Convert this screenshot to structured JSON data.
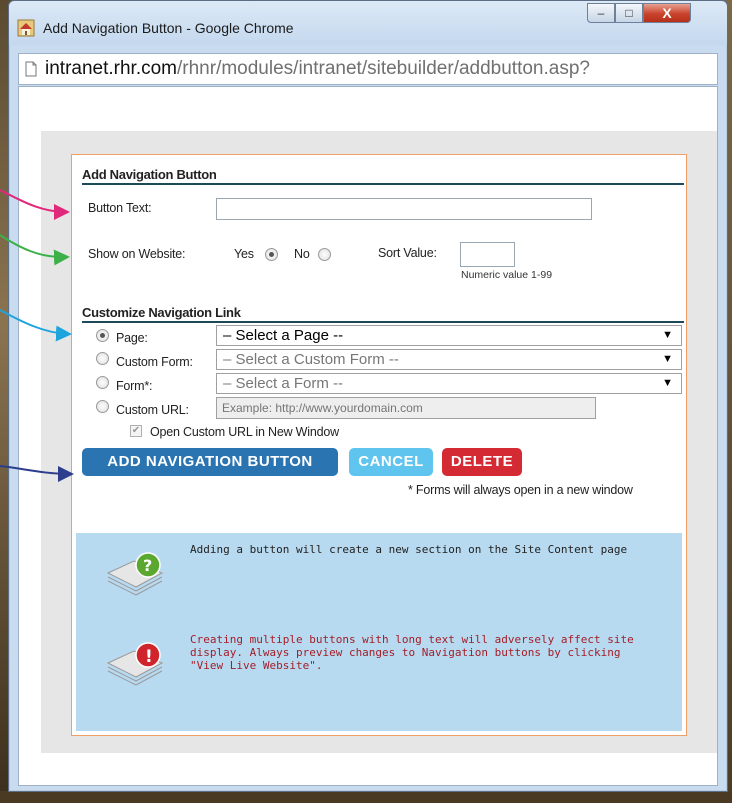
{
  "window": {
    "title": "Add Navigation Button - Google Chrome",
    "minimize_glyph": "–",
    "maximize_glyph": "□",
    "close_glyph": "X"
  },
  "address": {
    "host": "intranet.rhr.com",
    "path": "/rhnr/modules/intranet/sitebuilder/addbutton.asp?"
  },
  "form": {
    "heading": "Add Navigation Button",
    "button_text_label": "Button Text:",
    "button_text_value": "",
    "show_label": "Show on Website:",
    "yes_label": "Yes",
    "no_label": "No",
    "show_value": "Yes",
    "sort_label": "Sort Value:",
    "sort_value": "",
    "sort_hint": "Numeric value 1-99",
    "link_heading": "Customize Navigation Link",
    "link_type_selected": "Page",
    "page_label": "Page:",
    "page_select": "– Select a Page --",
    "custom_form_label": "Custom Form:",
    "custom_form_select": "– Select a Custom Form --",
    "form_label": "Form*:",
    "form_select": "– Select a Form --",
    "custom_url_label": "Custom URL:",
    "custom_url_placeholder": "Example: http://www.yourdomain.com",
    "open_new_window_label": "Open Custom URL in New Window",
    "open_new_window_checked": true,
    "select_arrow": "▼"
  },
  "buttons": {
    "add": "ADD NAVIGATION BUTTON",
    "cancel": "CANCEL",
    "delete": "DELETE"
  },
  "forms_note": "* Forms will always open in a new window",
  "info": {
    "tip": "Adding a button will create a new section on the Site Content page",
    "warning_lines": [
      "Creating multiple buttons with long text will adversely affect site",
      "display. Always preview changes to Navigation buttons by clicking",
      "\"View Live Website\"."
    ]
  },
  "colors": {
    "accent": "#2a74b1",
    "cancel": "#5fc4ee",
    "delete": "#d42a34",
    "panel_border": "#f0a066",
    "info_bg": "#b8daf0",
    "arrow_pink": "#e0287c",
    "arrow_green": "#3eb04a",
    "arrow_cyan": "#1ea4dc",
    "arrow_navy": "#2b3d8c"
  }
}
